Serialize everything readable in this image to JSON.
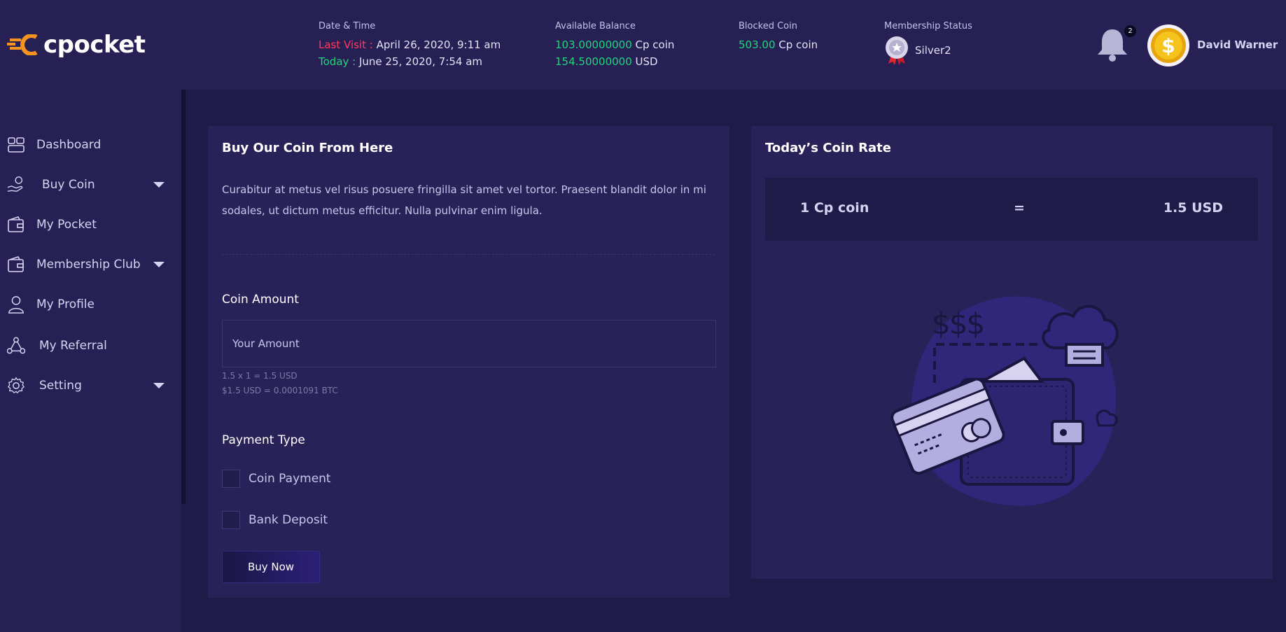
{
  "brand": {
    "logo_text": "cpocket",
    "accent_color": "#f7941d"
  },
  "header": {
    "datetime": {
      "label": "Date & Time",
      "last_visit_label": "Last Visit :",
      "last_visit_value": "April 26, 2020, 9:11 am",
      "today_label": "Today :",
      "today_value": "June 25, 2020, 7:54 am"
    },
    "balance": {
      "label": "Available Balance",
      "coin_amount": "103.00000000",
      "coin_unit": "Cp coin",
      "usd_amount": "154.50000000",
      "usd_unit": "USD"
    },
    "blocked": {
      "label": "Blocked Coin",
      "amount": "503.00",
      "unit": "Cp coin"
    },
    "membership": {
      "label": "Membership Status",
      "value": "Silver2",
      "icon": "medal-icon"
    },
    "notifications": {
      "count": "2",
      "icon": "bell-icon"
    },
    "user": {
      "name": "David Warner",
      "avatar_icon": "dollar-coin-icon"
    }
  },
  "sidebar": {
    "items": [
      {
        "label": "Dashboard",
        "icon": "dashboard-icon",
        "has_submenu": false
      },
      {
        "label": "Buy Coin",
        "icon": "hand-coin-icon",
        "has_submenu": true
      },
      {
        "label": "My Pocket",
        "icon": "wallet-icon",
        "has_submenu": false
      },
      {
        "label": "Membership Club",
        "icon": "wallet-icon",
        "has_submenu": true
      },
      {
        "label": "My Profile",
        "icon": "user-icon",
        "has_submenu": false
      },
      {
        "label": "My Referral",
        "icon": "network-icon",
        "has_submenu": false
      },
      {
        "label": "Setting",
        "icon": "gear-icon",
        "has_submenu": true
      }
    ]
  },
  "buy_card": {
    "title": "Buy Our Coin From Here",
    "description": "Curabitur at metus vel risus posuere fringilla sit amet vel tortor. Praesent blandit dolor in mi sodales, ut dictum metus efficitur. Nulla pulvinar enim ligula.",
    "amount_label": "Coin Amount",
    "amount_placeholder": "Your Amount",
    "amount_value": "",
    "hint_usd": "1.5 x 1 = 1.5 USD",
    "hint_btc": "$1.5 USD = 0.0001091 BTC",
    "payment_label": "Payment Type",
    "payment_options": [
      {
        "label": "Coin Payment",
        "checked": false
      },
      {
        "label": "Bank Deposit",
        "checked": false
      }
    ],
    "buy_button": "Buy Now"
  },
  "rate_card": {
    "title": "Today’s Coin Rate",
    "left": "1 Cp coin",
    "equals": "=",
    "right": "1.5 USD",
    "illustration": "wallet-cards-illustration"
  },
  "colors": {
    "background": "#1f1a48",
    "panel": "#262054",
    "card": "#282258",
    "positive": "#21d67a",
    "alert": "#ff3b5c"
  }
}
